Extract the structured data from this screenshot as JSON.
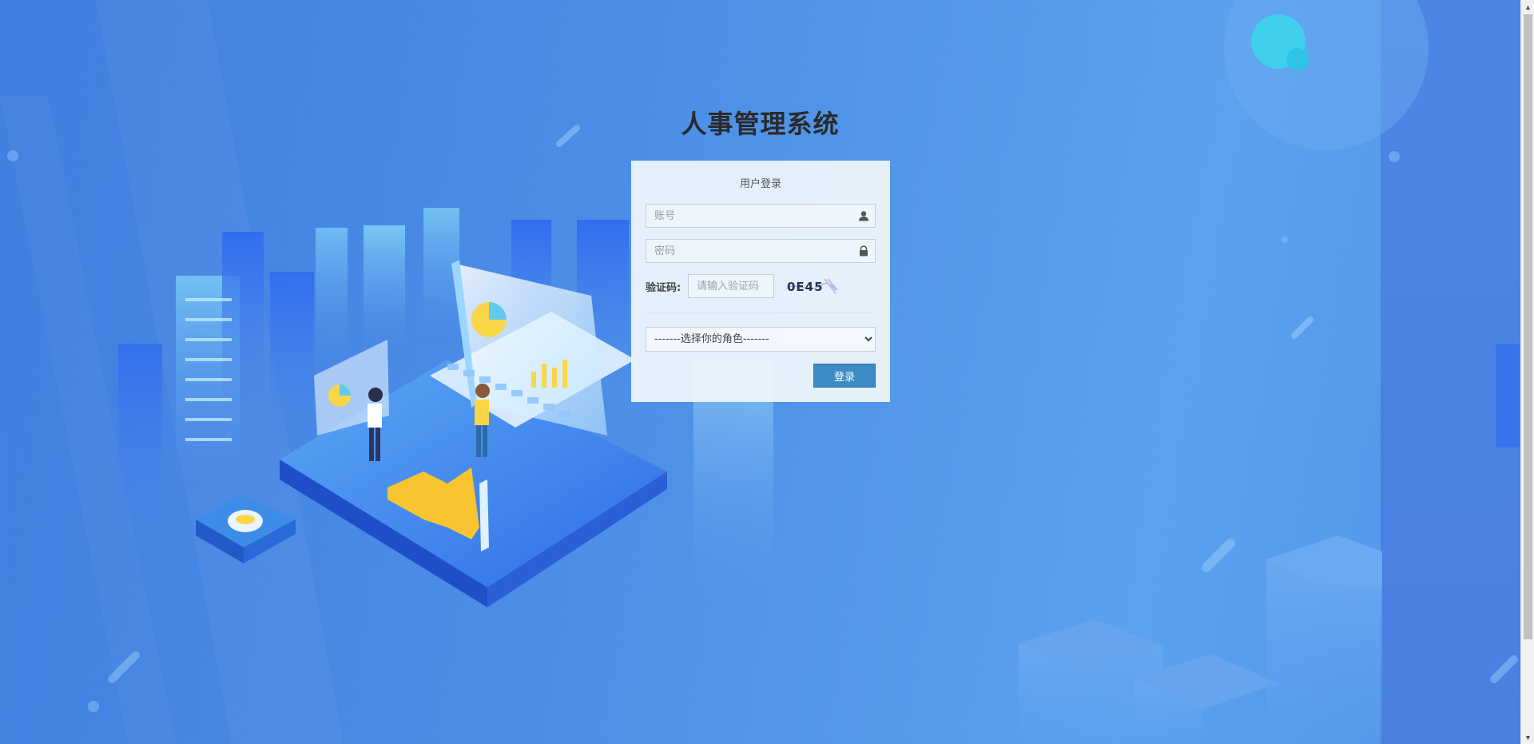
{
  "app": {
    "title": "人事管理系统"
  },
  "login": {
    "panel_title": "用户登录",
    "account_placeholder": "账号",
    "password_placeholder": "密码",
    "captcha_label": "验证码:",
    "captcha_placeholder": "请输入验证码",
    "captcha_text": "0E45",
    "role_select": "-------选择你的角色-------",
    "login_button": "登录"
  }
}
